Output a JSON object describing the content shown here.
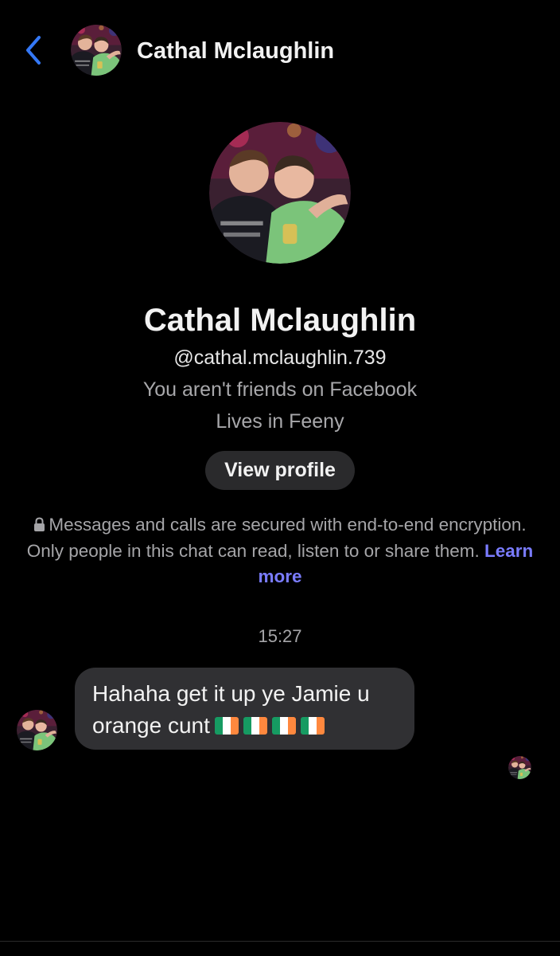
{
  "header": {
    "back_icon": "chevron-left-icon",
    "name": "Cathal Mclaughlin",
    "accent_color": "#3478f6"
  },
  "profile": {
    "name": "Cathal Mclaughlin",
    "username": "@cathal.mclaughlin.739",
    "friend_status": "You aren't friends on Facebook",
    "location": "Lives in Feeny",
    "view_profile_label": "View profile"
  },
  "encryption": {
    "icon": "lock-icon",
    "text": "Messages and calls are secured with end-to-end encryption. Only people in this chat can read, listen to or share them.",
    "link_label": "Learn more",
    "link_color": "#7a7cff"
  },
  "chat": {
    "timestamp": "15:27",
    "messages": [
      {
        "sender": "Cathal Mclaughlin",
        "text": "Hahaha get it up ye Jamie u orange cunt",
        "emoji": [
          "ireland-flag",
          "ireland-flag",
          "ireland-flag",
          "ireland-flag"
        ]
      }
    ]
  }
}
